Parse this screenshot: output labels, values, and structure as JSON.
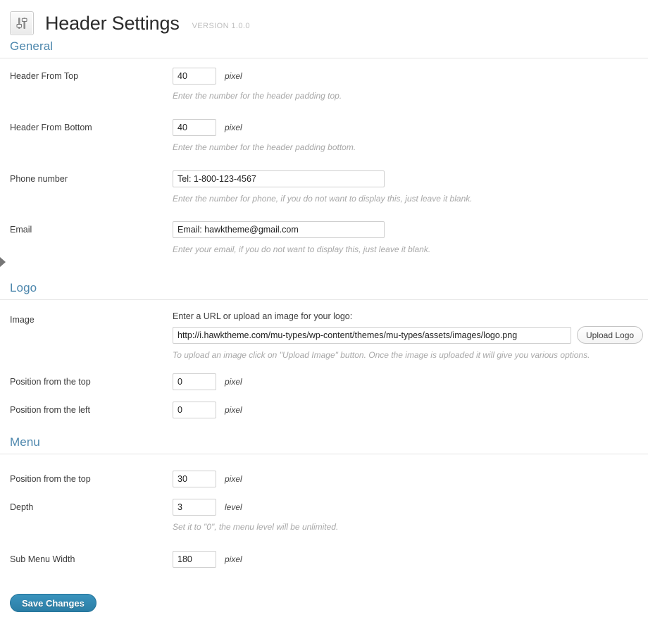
{
  "header": {
    "icon": "sliders-icon",
    "title": "Header Settings",
    "version": "VERSION 1.0.0"
  },
  "sections": [
    {
      "id": "general",
      "title": "General",
      "rows": [
        {
          "label": "Header From Top",
          "value": "40",
          "unit": "pixel",
          "hint": "Enter the number for the header padding top."
        },
        {
          "label": "Header From Bottom",
          "value": "40",
          "unit": "pixel",
          "hint": "Enter the number for the header padding bottom."
        },
        {
          "label": "Phone number",
          "value": "Tel: 1-800-123-4567",
          "unit": "",
          "hint": "Enter the number for phone, if you do not want to display this, just leave it blank."
        },
        {
          "label": "Email",
          "value": "Email: hawktheme@gmail.com",
          "unit": "",
          "hint": "Enter your email, if you do not want to display this, just leave it blank."
        }
      ]
    },
    {
      "id": "logo",
      "title": "Logo",
      "rows": [
        {
          "label": "Image",
          "sub_label": "Enter a URL or upload an image for your logo:",
          "value": "http://i.hawktheme.com/mu-types/wp-content/themes/mu-types/assets/images/logo.png",
          "button": "Upload Logo",
          "unit": "",
          "hint": "To upload an image click on \"Upload Image\" button. Once the image is uploaded it will give you various options."
        },
        {
          "label": "Position from the top",
          "value": "0",
          "unit": "pixel",
          "hint": ""
        },
        {
          "label": "Position from the left",
          "value": "0",
          "unit": "pixel",
          "hint": ""
        }
      ]
    },
    {
      "id": "menu",
      "title": "Menu",
      "rows": [
        {
          "label": "Position from the top",
          "value": "30",
          "unit": "pixel",
          "hint": ""
        },
        {
          "label": "Depth",
          "value": "3",
          "unit": "level",
          "hint": "Set it to \"0\", the menu level will be unlimited."
        },
        {
          "label": "Sub Menu Width",
          "value": "180",
          "unit": "pixel",
          "hint": ""
        }
      ]
    }
  ],
  "footer": {
    "save_label": "Save Changes"
  },
  "colors": {
    "section_heading": "#4d87ad",
    "save_button": "#2f86ae",
    "hint_text": "#a8a8a8",
    "version_text": "#bdbdbd"
  }
}
